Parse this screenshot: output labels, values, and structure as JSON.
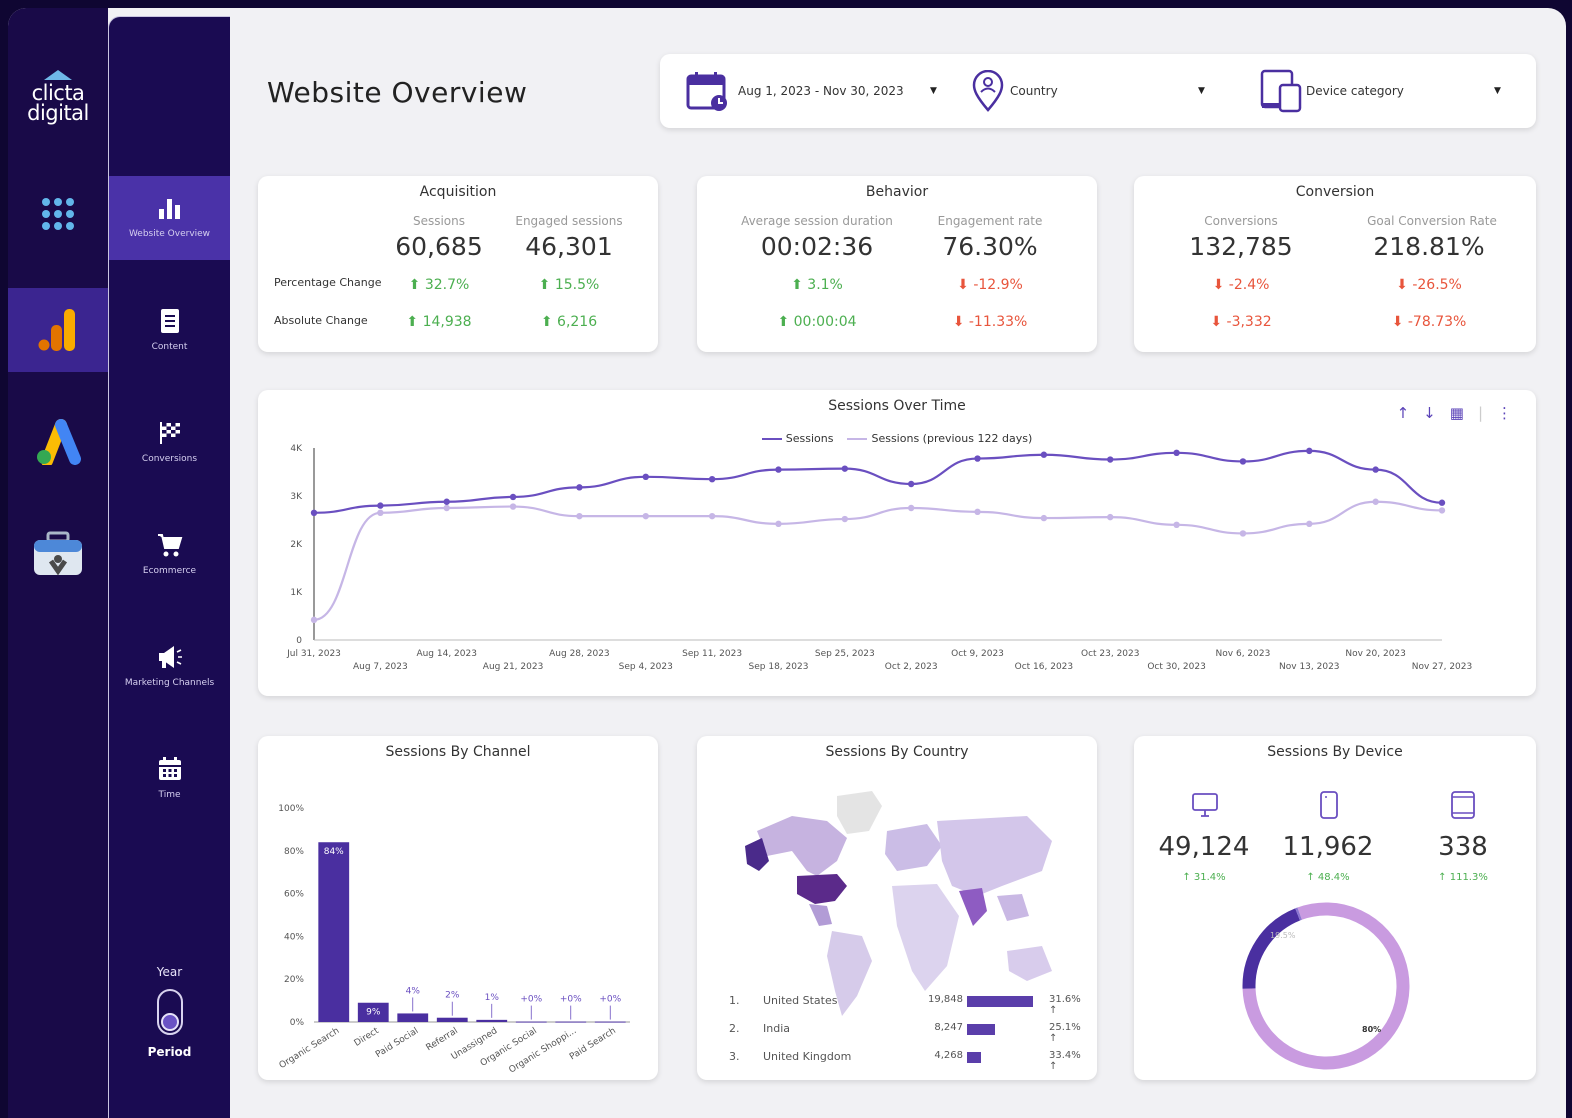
{
  "brand": {
    "logo_line1": "clicta",
    "logo_line2": "digital"
  },
  "subnav": {
    "items": [
      {
        "label": "Website Overview",
        "icon": "bar-chart-icon"
      },
      {
        "label": "Content",
        "icon": "document-icon"
      },
      {
        "label": "Conversions",
        "icon": "checkered-flag-icon"
      },
      {
        "label": "Ecommerce",
        "icon": "cart-icon"
      },
      {
        "label": "Marketing Channels",
        "icon": "megaphone-icon"
      },
      {
        "label": "Time",
        "icon": "calendar-icon"
      }
    ],
    "year_label": "Year",
    "period_label": "Period"
  },
  "header": {
    "title": "Website Overview"
  },
  "filters": {
    "date_range": "Aug 1, 2023 - Nov 30, 2023",
    "country": "Country",
    "device": "Device category"
  },
  "acquisition": {
    "title": "Acquisition",
    "sessions_label": "Sessions",
    "sessions_value": "60,685",
    "engaged_label": "Engaged sessions",
    "engaged_value": "46,301",
    "pct_label": "Percentage Change",
    "abs_label": "Absolute Change",
    "sessions_pct": "32.7%",
    "engaged_pct": "15.5%",
    "sessions_abs": "14,938",
    "engaged_abs": "6,216"
  },
  "behavior": {
    "title": "Behavior",
    "duration_label": "Average session duration",
    "duration_value": "00:02:36",
    "engagement_label": "Engagement rate",
    "engagement_value": "76.30%",
    "duration_pct": "3.1%",
    "engagement_pct": "-12.9%",
    "duration_abs": "00:00:04",
    "engagement_abs": "-11.33%"
  },
  "conversion": {
    "title": "Conversion",
    "conversions_label": "Conversions",
    "conversions_value": "132,785",
    "rate_label": "Goal Conversion Rate",
    "rate_value": "218.81%",
    "conversions_pct": "-2.4%",
    "rate_pct": "-26.5%",
    "conversions_abs": "-3,332",
    "rate_abs": "-78.73%"
  },
  "colors": {
    "primary": "#6a4fc0",
    "secondary": "#c6b6e6",
    "up": "#4caf50",
    "down": "#e8553c"
  },
  "chart_data": [
    {
      "type": "line",
      "title": "Sessions Over Time",
      "x": [
        "Jul 31, 2023",
        "Aug 7, 2023",
        "Aug 14, 2023",
        "Aug 21, 2023",
        "Aug 28, 2023",
        "Sep 4, 2023",
        "Sep 11, 2023",
        "Sep 18, 2023",
        "Sep 25, 2023",
        "Oct 2, 2023",
        "Oct 9, 2023",
        "Oct 16, 2023",
        "Oct 23, 2023",
        "Oct 30, 2023",
        "Nov 6, 2023",
        "Nov 13, 2023",
        "Nov 20, 2023",
        "Nov 27, 2023"
      ],
      "series": [
        {
          "name": "Sessions",
          "color": "#6a4fc0",
          "values": [
            2650,
            2800,
            2880,
            2980,
            3180,
            3400,
            3350,
            3550,
            3570,
            3250,
            3780,
            3860,
            3760,
            3900,
            3720,
            3940,
            3550,
            2860
          ]
        },
        {
          "name": "Sessions (previous 122 days)",
          "color": "#c6b6e6",
          "values": [
            420,
            2650,
            2750,
            2780,
            2580,
            2580,
            2580,
            2420,
            2520,
            2750,
            2670,
            2540,
            2560,
            2400,
            2220,
            2420,
            2880,
            2700
          ]
        }
      ],
      "yticks": [
        "0",
        "1K",
        "2K",
        "3K",
        "4K"
      ],
      "ylim": [
        0,
        4000
      ],
      "grid": false,
      "legend": "top"
    },
    {
      "type": "bar",
      "title": "Sessions By Channel",
      "categories": [
        "Organic Search",
        "Direct",
        "Paid Social",
        "Referral",
        "Unassigned",
        "Organic Social",
        "Organic Shoppi...",
        "Paid Search"
      ],
      "values": [
        84,
        9,
        4,
        2,
        1,
        0.2,
        0.2,
        0.2
      ],
      "labels": [
        "84%",
        "9%",
        "4%",
        "2%",
        "1%",
        "+0%",
        "+0%",
        "+0%"
      ],
      "yticks": [
        "0%",
        "20%",
        "40%",
        "60%",
        "80%",
        "100%"
      ],
      "ylim": [
        0,
        100
      ]
    },
    {
      "type": "pie",
      "title": "Sessions By Device",
      "slices": [
        {
          "name": "desktop",
          "value": 80,
          "label": "80%",
          "color": "#c99be0"
        },
        {
          "name": "mobile",
          "value": 19.5,
          "label": "19.5%",
          "color": "#4a2fa0"
        },
        {
          "name": "tablet",
          "value": 0.5,
          "label": "",
          "color": "#8a75d0"
        }
      ]
    }
  ],
  "country": {
    "title": "Sessions By Country",
    "rows": [
      {
        "rank": "1.",
        "name": "United States",
        "value": "19,848",
        "bar": 1.0,
        "pct": "31.6% ↑"
      },
      {
        "rank": "2.",
        "name": "India",
        "value": "8,247",
        "bar": 0.42,
        "pct": "25.1% ↑"
      },
      {
        "rank": "3.",
        "name": "United Kingdom",
        "value": "4,268",
        "bar": 0.21,
        "pct": "33.4% ↑"
      }
    ]
  },
  "devices": {
    "title": "Sessions By Device",
    "items": [
      {
        "icon": "desktop-icon",
        "value": "49,124",
        "change": "↑ 31.4%"
      },
      {
        "icon": "mobile-icon",
        "value": "11,962",
        "change": "↑ 48.4%"
      },
      {
        "icon": "tablet-icon",
        "value": "338",
        "change": "↑ 111.3%"
      }
    ]
  }
}
